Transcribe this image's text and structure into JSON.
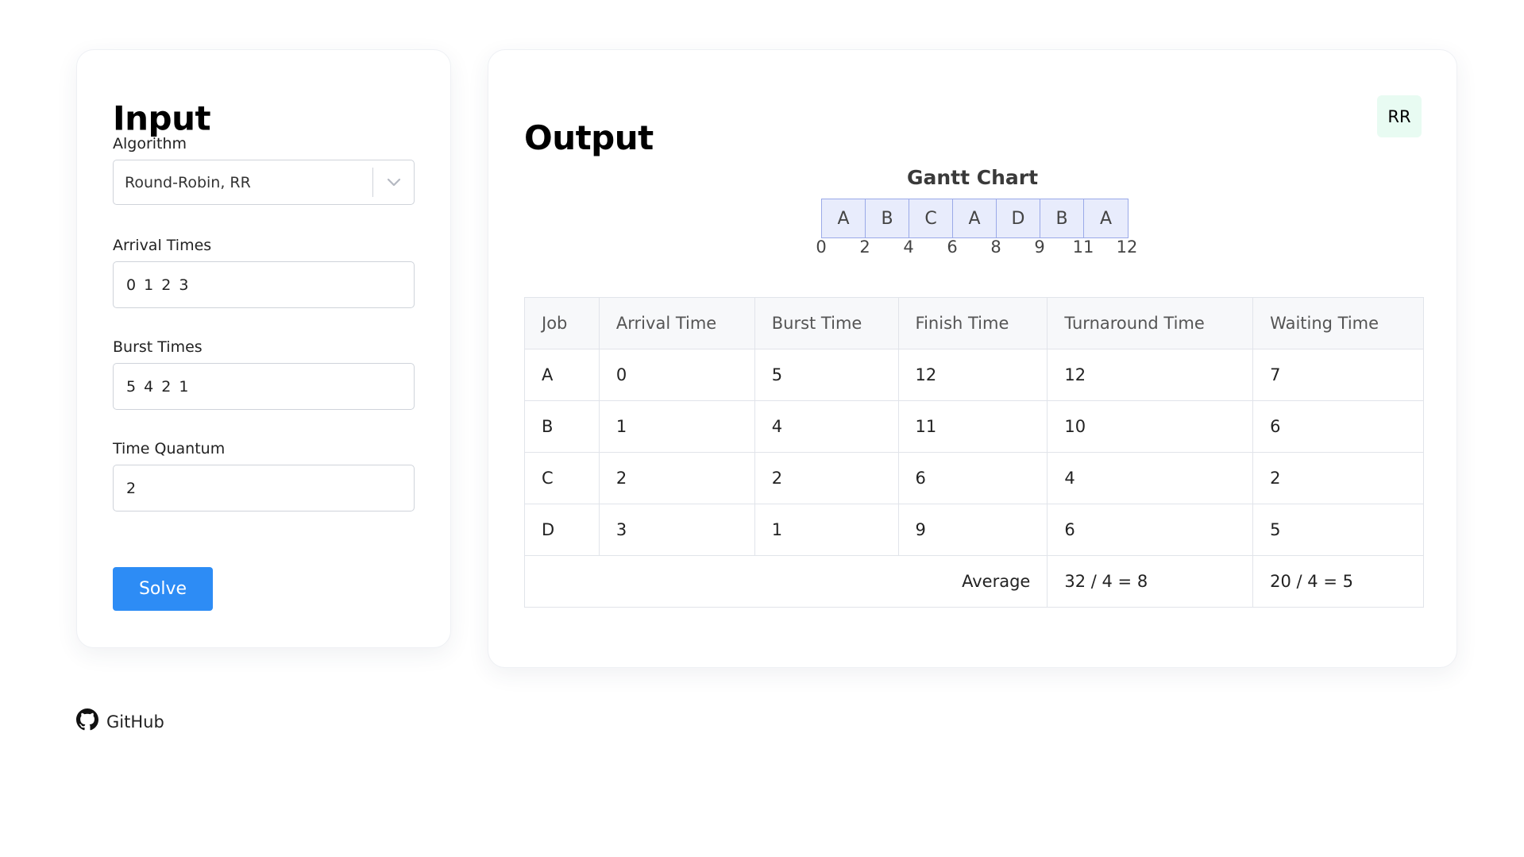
{
  "input": {
    "title": "Input",
    "algorithm_label": "Algorithm",
    "algorithm_value": "Round-Robin, RR",
    "arrival_label": "Arrival Times",
    "arrival_value": "0 1 2 3",
    "burst_label": "Burst Times",
    "burst_value": "5 4 2 1",
    "quantum_label": "Time Quantum",
    "quantum_value": "2",
    "solve_label": "Solve"
  },
  "output": {
    "title": "Output",
    "badge": "RR",
    "gantt": {
      "title": "Gantt Chart",
      "blocks": [
        "A",
        "B",
        "C",
        "A",
        "D",
        "B",
        "A"
      ],
      "ticks": [
        "0",
        "2",
        "4",
        "6",
        "8",
        "9",
        "11",
        "12"
      ]
    },
    "table": {
      "headers": [
        "Job",
        "Arrival Time",
        "Burst Time",
        "Finish Time",
        "Turnaround Time",
        "Waiting Time"
      ],
      "rows": [
        [
          "A",
          "0",
          "5",
          "12",
          "12",
          "7"
        ],
        [
          "B",
          "1",
          "4",
          "11",
          "10",
          "6"
        ],
        [
          "C",
          "2",
          "2",
          "6",
          "4",
          "2"
        ],
        [
          "D",
          "3",
          "1",
          "9",
          "6",
          "5"
        ]
      ],
      "average_label": "Average",
      "average_turnaround": "32 / 4 = 8",
      "average_waiting": "20 / 4 = 5"
    }
  },
  "footer": {
    "github_label": "GitHub"
  },
  "colors": {
    "solve_button": "#2d8cf5",
    "badge_bg": "#e8fbf2",
    "gantt_fill": "#e8ecfc",
    "gantt_border": "#9aa9e8"
  }
}
